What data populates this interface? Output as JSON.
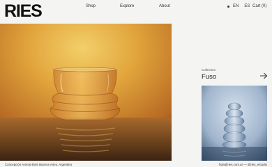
{
  "brand": {
    "logo": "RIES"
  },
  "nav": {
    "shop": "Shop",
    "explore": "Explore",
    "about": "About"
  },
  "lang": {
    "en": "EN",
    "es": "ES",
    "active": "EN"
  },
  "cart": {
    "label": "Cart (0)"
  },
  "collection": {
    "kicker": "Collection",
    "name": "Fuso",
    "arrow_icon": "arrow-right-icon"
  },
  "footer": {
    "address": "Concepción Arenal 4646 Buenos Aires, Argentina",
    "contact": "hola@ries.com.ar — @ries_estudio"
  },
  "colors": {
    "background": "#f4f4f2",
    "hero_amber": "#d9a53a",
    "thumb_blue": "#8aa0b8"
  }
}
